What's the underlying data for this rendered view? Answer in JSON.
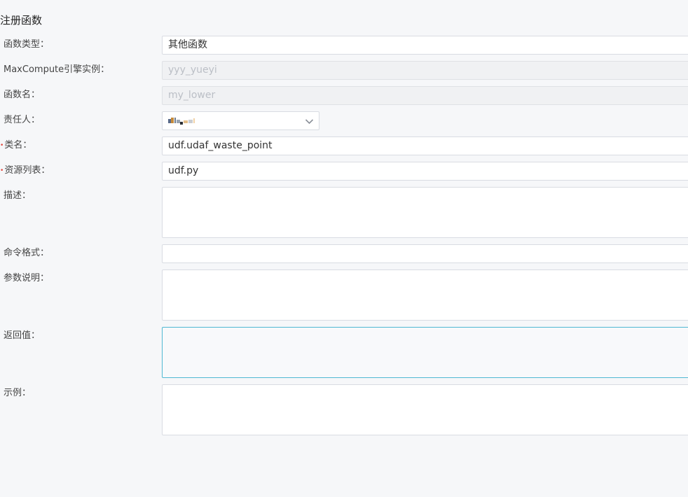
{
  "title": "注册函数",
  "form": {
    "function_type": {
      "label": "函数类型：",
      "value": "其他函数"
    },
    "engine_instance": {
      "label": "MaxCompute引擎实例：",
      "value": "yyy_yueyi"
    },
    "function_name": {
      "label": "函数名：",
      "value": "my_lower"
    },
    "owner": {
      "label": "责任人：",
      "value_icon": "blurred-name"
    },
    "class_name": {
      "label": "类名：",
      "value": "udf.udaf_waste_point",
      "required": true
    },
    "resource_list": {
      "label": "资源列表：",
      "value": "udf.py",
      "required": true
    },
    "description": {
      "label": "描述：",
      "value": ""
    },
    "command_format": {
      "label": "命令格式：",
      "value": ""
    },
    "parameter_desc": {
      "label": "参数说明：",
      "value": ""
    },
    "return_value": {
      "label": "返回值：",
      "value": ""
    },
    "example": {
      "label": "示例：",
      "value": ""
    }
  },
  "colors": {
    "required_marker": "#e0443a",
    "focus_border": "#4fb8d2",
    "input_border": "#d9dce2",
    "disabled_text": "#bbbfc6"
  }
}
